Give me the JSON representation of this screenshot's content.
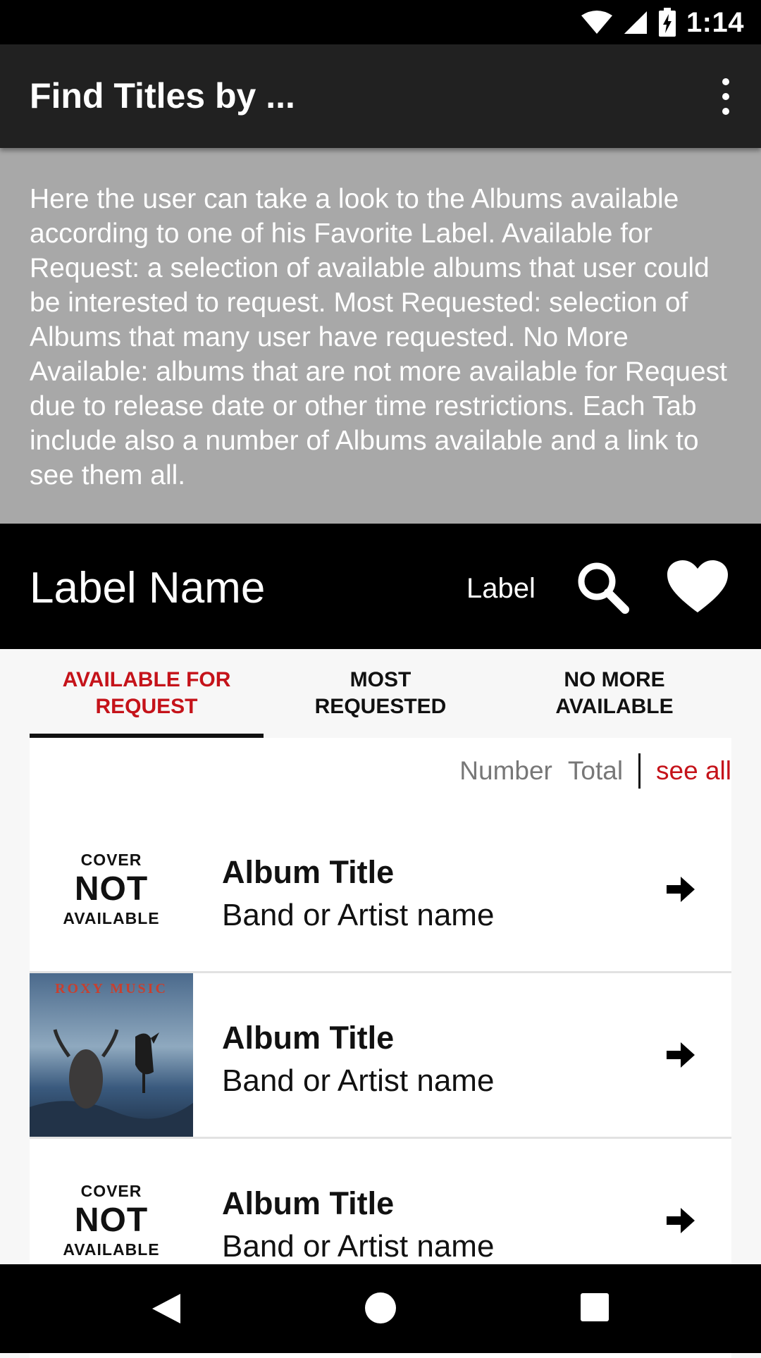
{
  "status_bar": {
    "time": "1:14"
  },
  "app_bar": {
    "title": "Find Titles by ..."
  },
  "description": "Here the user can take a look to the Albums available according to one of his Favorite Label. Available for Request: a selection of available albums that user could be interested to request. Most Requested: selection of Albums that many user have requested. No More Available: albums that are not more available for Request due to release date or other time restrictions. Each Tab include also a number of Albums available and a link to see them all.",
  "label_bar": {
    "name": "Label Name",
    "label": "Label"
  },
  "tabs": [
    {
      "label": "AVAILABLE FOR REQUEST",
      "active": true
    },
    {
      "label": "MOST REQUESTED",
      "active": false
    },
    {
      "label": "NO MORE AVAILABLE",
      "active": false
    }
  ],
  "counts": {
    "number": "Number",
    "total": "Total",
    "see_all": "see all"
  },
  "placeholder_cover": {
    "line1": "COVER",
    "line2": "NOT",
    "line3": "AVAILABLE"
  },
  "cover_art_text": "ROXY MUSIC",
  "albums": [
    {
      "title": "Album Title",
      "artist": "Band or Artist name",
      "cover": "placeholder"
    },
    {
      "title": "Album Title",
      "artist": "Band or Artist name",
      "cover": "artwork"
    },
    {
      "title": "Album Title",
      "artist": "Band or Artist name",
      "cover": "placeholder"
    }
  ],
  "colors": {
    "accent": "#c5131a",
    "app_bar": "#212121",
    "description_bg": "#a8a8a8"
  }
}
